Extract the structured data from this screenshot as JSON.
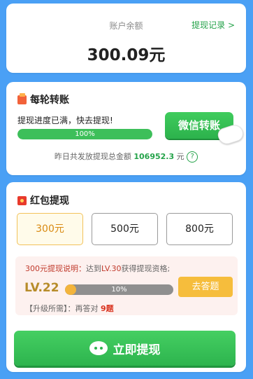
{
  "balance": {
    "label": "账户余额",
    "records_link": "提现记录 >",
    "amount": "300.09元"
  },
  "transfer": {
    "title": "每轮转账",
    "progress_text": "提现进度已满，快去提现!",
    "progress_percent": 100,
    "progress_label": "100%",
    "button_label": "微信转账",
    "yesterday_prefix": "昨日共发放提现总金额",
    "yesterday_amount": "106952.3",
    "yesterday_unit": "元",
    "help_symbol": "?"
  },
  "redpacket": {
    "title": "红包提现",
    "options": [
      "300元",
      "500元",
      "800元"
    ],
    "selected_index": 0,
    "desc_a": "300元提现说明：",
    "desc_b": "达到",
    "desc_c": "LV.30",
    "desc_d": "获得提现资格;",
    "level": "LV.22",
    "level_percent": 10,
    "level_label": "10%",
    "answer_button": "去答题",
    "upgrade_prefix": "【升级所需】：再答对",
    "upgrade_count": "9题",
    "withdraw_button": "立即提现"
  },
  "colors": {
    "background": "#4aa0f5",
    "green": "#2cb24c",
    "gold": "#f6bd3c",
    "red": "#d9331f"
  }
}
